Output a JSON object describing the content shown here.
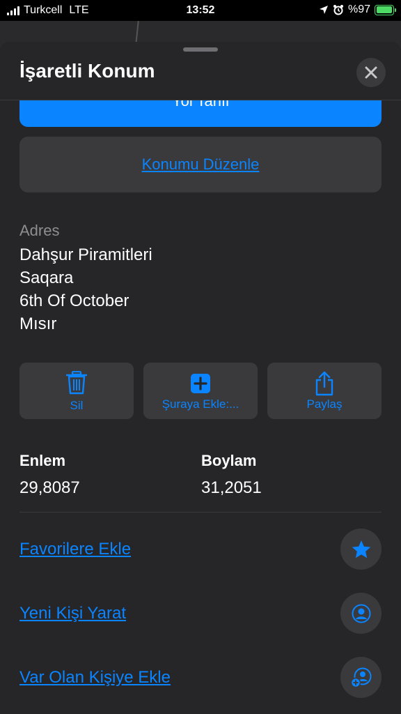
{
  "status_bar": {
    "carrier": "Turkcell",
    "network": "LTE",
    "time": "13:52",
    "battery": "%97",
    "battery_level": 0.97
  },
  "sheet": {
    "title": "İşaretli Konum",
    "directions_label": "Yol Tarifi",
    "edit_location_label": "Konumu Düzenle"
  },
  "address": {
    "label": "Adres",
    "line1": "Dahşur Piramitleri",
    "line2": "Saqara",
    "line3": "6th Of October",
    "line4": "Mısır"
  },
  "actions": {
    "delete_label": "Sil",
    "add_to_label": "Şuraya Ekle:...",
    "share_label": "Paylaş"
  },
  "coordinates": {
    "latitude_label": "Enlem",
    "latitude_value": "29,8087",
    "longitude_label": "Boylam",
    "longitude_value": "31,2051"
  },
  "links": {
    "favorites": "Favorilere Ekle",
    "new_contact": "Yeni Kişi Yarat",
    "existing_contact": "Var Olan Kişiye Ekle"
  },
  "colors": {
    "accent": "#0a84ff",
    "background": "#262628",
    "button_bg": "#3a3a3c",
    "battery": "#4cd964"
  },
  "icons": {
    "close": "close-icon",
    "delete": "trash-icon",
    "add": "plus-square-icon",
    "share": "share-icon",
    "favorite": "star-icon",
    "contact": "person-circle-icon",
    "add_contact": "person-add-icon"
  }
}
